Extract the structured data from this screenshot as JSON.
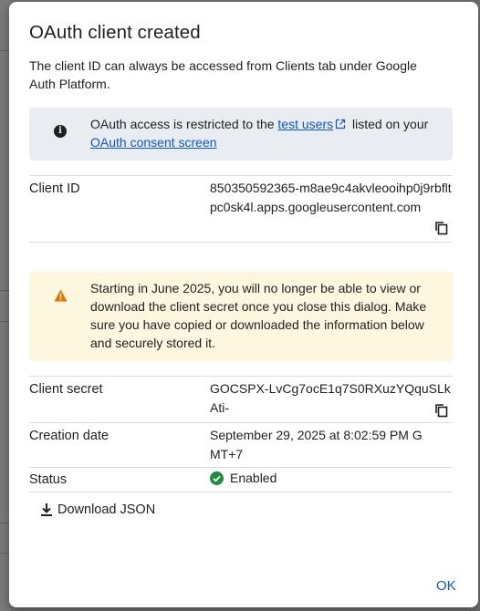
{
  "dialog": {
    "title": "OAuth client created",
    "intro": "The client ID can always be accessed from Clients tab under Google Auth Platform."
  },
  "info_notice": {
    "icon": "info-icon",
    "text_before": "OAuth access is restricted to the ",
    "test_users_link": "test users",
    "text_middle": " listed on your ",
    "consent_link": "OAuth consent screen"
  },
  "client_id": {
    "label": "Client ID",
    "value": "850350592365-m8ae9c4akvleooihp0j9rbfltpc0sk4l.apps.googleusercontent.com"
  },
  "warning": {
    "icon": "warning-icon",
    "text": "Starting in June 2025, you will no longer be able to view or download the client secret once you close this dialog. Make sure you have copied or downloaded the information below and securely stored it."
  },
  "client_secret": {
    "label": "Client secret",
    "value": "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"
  },
  "creation_date": {
    "label": "Creation date",
    "value": "September 29, 2025 at 8:02:59 PM GMT+7"
  },
  "status": {
    "label": "Status",
    "value": "Enabled",
    "color": "#1e8e3e"
  },
  "actions": {
    "download_label": "Download JSON",
    "ok_label": "OK"
  },
  "colors": {
    "link": "#0b57d0",
    "info_bg": "#e9ecf1",
    "warning_bg": "#fef7e0",
    "warning_icon": "#e37400"
  }
}
